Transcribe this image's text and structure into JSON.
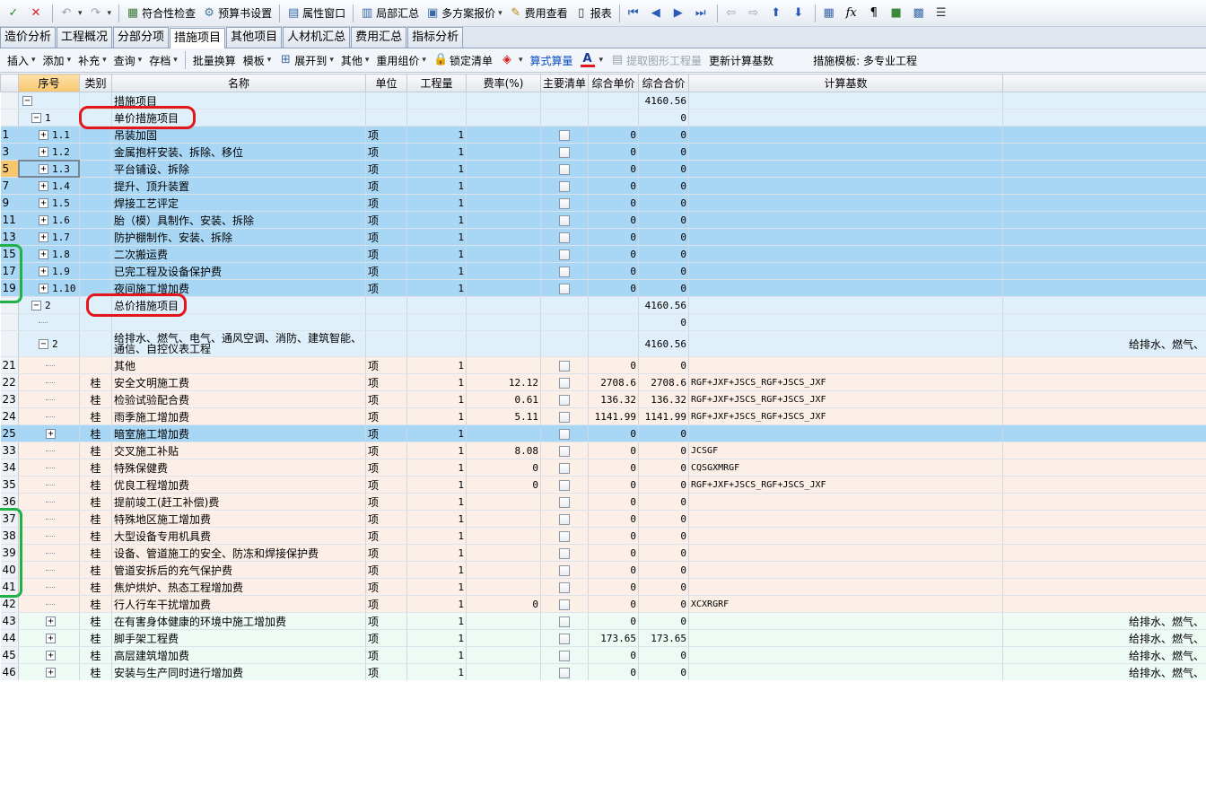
{
  "toolbar1": {
    "compliance_check": "符合性检查",
    "budget_settings": "预算书设置",
    "property_window": "属性窗口",
    "local_summary": "局部汇总",
    "multi_plan_quote": "多方案报价",
    "fee_view": "费用查看",
    "report": "报表"
  },
  "tabs": [
    "造价分析",
    "工程概况",
    "分部分项",
    "措施项目",
    "其他项目",
    "人材机汇总",
    "费用汇总",
    "指标分析"
  ],
  "active_tab": "措施项目",
  "toolbar2": {
    "insert": "插入",
    "add": "添加",
    "supplement": "补充",
    "query": "查询",
    "save": "存档",
    "batch_convert": "批量换算",
    "template": "模板",
    "expand_to": "展开到",
    "other": "其他",
    "reuse_price": "重用组价",
    "lock_list": "锁定清单",
    "formula_calc": "算式算量",
    "extract_quantity": "提取图形工程量",
    "update_base": "更新计算基数",
    "template_label": "措施模板:",
    "template_value": "多专业工程"
  },
  "columns": [
    "序号",
    "类别",
    "名称",
    "单位",
    "工程量",
    "费率(%)",
    "主要清单",
    "综合单价",
    "综合合价",
    "计算基数"
  ],
  "rows": [
    {
      "rn": "",
      "seq": "",
      "cat": "",
      "name": "措施项目",
      "unit": "",
      "qty": "",
      "rate": "",
      "cb": false,
      "price": "",
      "total": "4160.56",
      "base": "",
      "extra": "",
      "style": "hdr",
      "lvl": 0,
      "toggle": "−"
    },
    {
      "rn": "",
      "seq": "1",
      "cat": "",
      "name": "单价措施项目",
      "unit": "",
      "qty": "",
      "rate": "",
      "cb": false,
      "price": "",
      "total": "0",
      "base": "",
      "extra": "",
      "style": "hdr",
      "lvl": 1,
      "toggle": "−"
    },
    {
      "rn": "1",
      "seq": "1.1",
      "cat": "",
      "name": "吊装加固",
      "unit": "项",
      "qty": "1",
      "rate": "",
      "cb": true,
      "price": "0",
      "total": "0",
      "base": "",
      "extra": "",
      "style": "blue",
      "lvl": 2,
      "toggle": "+"
    },
    {
      "rn": "3",
      "seq": "1.2",
      "cat": "",
      "name": "金属抱杆安装、拆除、移位",
      "unit": "项",
      "qty": "1",
      "rate": "",
      "cb": true,
      "price": "0",
      "total": "0",
      "base": "",
      "extra": "",
      "style": "blue",
      "lvl": 2,
      "toggle": "+"
    },
    {
      "rn": "5",
      "seq": "1.3",
      "cat": "",
      "name": "平台铺设、拆除",
      "unit": "项",
      "qty": "1",
      "rate": "",
      "cb": true,
      "price": "0",
      "total": "0",
      "base": "",
      "extra": "",
      "style": "blue",
      "lvl": 2,
      "toggle": "+",
      "sel": true
    },
    {
      "rn": "7",
      "seq": "1.4",
      "cat": "",
      "name": "提升、顶升装置",
      "unit": "项",
      "qty": "1",
      "rate": "",
      "cb": true,
      "price": "0",
      "total": "0",
      "base": "",
      "extra": "",
      "style": "blue",
      "lvl": 2,
      "toggle": "+"
    },
    {
      "rn": "9",
      "seq": "1.5",
      "cat": "",
      "name": "焊接工艺评定",
      "unit": "项",
      "qty": "1",
      "rate": "",
      "cb": true,
      "price": "0",
      "total": "0",
      "base": "",
      "extra": "",
      "style": "blue",
      "lvl": 2,
      "toggle": "+"
    },
    {
      "rn": "11",
      "seq": "1.6",
      "cat": "",
      "name": "胎（模）具制作、安装、拆除",
      "unit": "项",
      "qty": "1",
      "rate": "",
      "cb": true,
      "price": "0",
      "total": "0",
      "base": "",
      "extra": "",
      "style": "blue",
      "lvl": 2,
      "toggle": "+"
    },
    {
      "rn": "13",
      "seq": "1.7",
      "cat": "",
      "name": "防护棚制作、安装、拆除",
      "unit": "项",
      "qty": "1",
      "rate": "",
      "cb": true,
      "price": "0",
      "total": "0",
      "base": "",
      "extra": "",
      "style": "blue",
      "lvl": 2,
      "toggle": "+"
    },
    {
      "rn": "15",
      "seq": "1.8",
      "cat": "",
      "name": "二次搬运费",
      "unit": "项",
      "qty": "1",
      "rate": "",
      "cb": true,
      "price": "0",
      "total": "0",
      "base": "",
      "extra": "",
      "style": "blue",
      "lvl": 2,
      "toggle": "+"
    },
    {
      "rn": "17",
      "seq": "1.9",
      "cat": "",
      "name": "已完工程及设备保护费",
      "unit": "项",
      "qty": "1",
      "rate": "",
      "cb": true,
      "price": "0",
      "total": "0",
      "base": "",
      "extra": "",
      "style": "blue",
      "lvl": 2,
      "toggle": "+"
    },
    {
      "rn": "19",
      "seq": "1.10",
      "cat": "",
      "name": "夜间施工增加费",
      "unit": "项",
      "qty": "1",
      "rate": "",
      "cb": true,
      "price": "0",
      "total": "0",
      "base": "",
      "extra": "",
      "style": "blue",
      "lvl": 2,
      "toggle": "+"
    },
    {
      "rn": "",
      "seq": "2",
      "cat": "",
      "name": "总价措施项目",
      "unit": "",
      "qty": "",
      "rate": "",
      "cb": false,
      "price": "",
      "total": "4160.56",
      "base": "",
      "extra": "",
      "style": "hdr",
      "lvl": 1,
      "toggle": "−"
    },
    {
      "rn": "",
      "seq": "",
      "cat": "",
      "name": "",
      "unit": "",
      "qty": "",
      "rate": "",
      "cb": false,
      "price": "",
      "total": "0",
      "base": "",
      "extra": "",
      "style": "hdr",
      "lvl": 2,
      "toggle": ""
    },
    {
      "rn": "",
      "seq": "2",
      "cat": "",
      "name": "给排水、燃气、电气、通风空调、消防、建筑智能、通信、自控仪表工程",
      "unit": "",
      "qty": "",
      "rate": "",
      "cb": false,
      "price": "",
      "total": "4160.56",
      "base": "",
      "extra": "给排水、燃气、",
      "style": "hdr tall",
      "lvl": 2,
      "toggle": "−"
    },
    {
      "rn": "21",
      "seq": "",
      "cat": "",
      "name": "其他",
      "unit": "项",
      "qty": "1",
      "rate": "",
      "cb": true,
      "price": "0",
      "total": "0",
      "base": "",
      "extra": "",
      "style": "pink",
      "lvl": 3,
      "toggle": ""
    },
    {
      "rn": "22",
      "seq": "",
      "cat": "桂",
      "name": "安全文明施工费",
      "unit": "项",
      "qty": "1",
      "rate": "12.12",
      "cb": true,
      "price": "2708.6",
      "total": "2708.6",
      "base": "RGF+JXF+JSCS_RGF+JSCS_JXF",
      "extra": "",
      "style": "pink",
      "lvl": 3,
      "toggle": ""
    },
    {
      "rn": "23",
      "seq": "",
      "cat": "桂",
      "name": "检验试验配合费",
      "unit": "项",
      "qty": "1",
      "rate": "0.61",
      "cb": true,
      "price": "136.32",
      "total": "136.32",
      "base": "RGF+JXF+JSCS_RGF+JSCS_JXF",
      "extra": "",
      "style": "pink",
      "lvl": 3,
      "toggle": ""
    },
    {
      "rn": "24",
      "seq": "",
      "cat": "桂",
      "name": "雨季施工增加费",
      "unit": "项",
      "qty": "1",
      "rate": "5.11",
      "cb": true,
      "price": "1141.99",
      "total": "1141.99",
      "base": "RGF+JXF+JSCS_RGF+JSCS_JXF",
      "extra": "",
      "style": "pink",
      "lvl": 3,
      "toggle": ""
    },
    {
      "rn": "25",
      "seq": "",
      "cat": "桂",
      "name": "暗室施工增加费",
      "unit": "项",
      "qty": "1",
      "rate": "",
      "cb": true,
      "price": "0",
      "total": "0",
      "base": "",
      "extra": "",
      "style": "blue",
      "lvl": 3,
      "toggle": "+"
    },
    {
      "rn": "33",
      "seq": "",
      "cat": "桂",
      "name": "交叉施工补贴",
      "unit": "项",
      "qty": "1",
      "rate": "8.08",
      "cb": true,
      "price": "0",
      "total": "0",
      "base": "JCSGF",
      "extra": "",
      "style": "pink",
      "lvl": 3,
      "toggle": ""
    },
    {
      "rn": "34",
      "seq": "",
      "cat": "桂",
      "name": "特殊保健费",
      "unit": "项",
      "qty": "1",
      "rate": "0",
      "cb": true,
      "price": "0",
      "total": "0",
      "base": "CQSGXMRGF",
      "extra": "",
      "style": "pink",
      "lvl": 3,
      "toggle": ""
    },
    {
      "rn": "35",
      "seq": "",
      "cat": "桂",
      "name": "优良工程增加费",
      "unit": "项",
      "qty": "1",
      "rate": "0",
      "cb": true,
      "price": "0",
      "total": "0",
      "base": "RGF+JXF+JSCS_RGF+JSCS_JXF",
      "extra": "",
      "style": "pink",
      "lvl": 3,
      "toggle": ""
    },
    {
      "rn": "36",
      "seq": "",
      "cat": "桂",
      "name": "提前竣工(赶工补偿)费",
      "unit": "项",
      "qty": "1",
      "rate": "",
      "cb": true,
      "price": "0",
      "total": "0",
      "base": "",
      "extra": "",
      "style": "pink",
      "lvl": 3,
      "toggle": ""
    },
    {
      "rn": "37",
      "seq": "",
      "cat": "桂",
      "name": "特殊地区施工增加费",
      "unit": "项",
      "qty": "1",
      "rate": "",
      "cb": true,
      "price": "0",
      "total": "0",
      "base": "",
      "extra": "",
      "style": "pink",
      "lvl": 3,
      "toggle": ""
    },
    {
      "rn": "38",
      "seq": "",
      "cat": "桂",
      "name": "大型设备专用机具费",
      "unit": "项",
      "qty": "1",
      "rate": "",
      "cb": true,
      "price": "0",
      "total": "0",
      "base": "",
      "extra": "",
      "style": "pink",
      "lvl": 3,
      "toggle": ""
    },
    {
      "rn": "39",
      "seq": "",
      "cat": "桂",
      "name": "设备、管道施工的安全、防冻和焊接保护费",
      "unit": "项",
      "qty": "1",
      "rate": "",
      "cb": true,
      "price": "0",
      "total": "0",
      "base": "",
      "extra": "",
      "style": "pink",
      "lvl": 3,
      "toggle": ""
    },
    {
      "rn": "40",
      "seq": "",
      "cat": "桂",
      "name": "管道安拆后的充气保护费",
      "unit": "项",
      "qty": "1",
      "rate": "",
      "cb": true,
      "price": "0",
      "total": "0",
      "base": "",
      "extra": "",
      "style": "pink",
      "lvl": 3,
      "toggle": ""
    },
    {
      "rn": "41",
      "seq": "",
      "cat": "桂",
      "name": "焦炉烘炉、热态工程增加费",
      "unit": "项",
      "qty": "1",
      "rate": "",
      "cb": true,
      "price": "0",
      "total": "0",
      "base": "",
      "extra": "",
      "style": "pink",
      "lvl": 3,
      "toggle": ""
    },
    {
      "rn": "42",
      "seq": "",
      "cat": "桂",
      "name": "行人行车干扰增加费",
      "unit": "项",
      "qty": "1",
      "rate": "0",
      "cb": true,
      "price": "0",
      "total": "0",
      "base": "XCXRGRF",
      "extra": "",
      "style": "pink",
      "lvl": 3,
      "toggle": ""
    },
    {
      "rn": "43",
      "seq": "",
      "cat": "桂",
      "name": "在有害身体健康的环境中施工增加费",
      "unit": "项",
      "qty": "1",
      "rate": "",
      "cb": true,
      "price": "0",
      "total": "0",
      "base": "",
      "extra": "给排水、燃气、",
      "style": "green",
      "lvl": 3,
      "toggle": "+"
    },
    {
      "rn": "44",
      "seq": "",
      "cat": "桂",
      "name": "脚手架工程费",
      "unit": "项",
      "qty": "1",
      "rate": "",
      "cb": true,
      "price": "173.65",
      "total": "173.65",
      "base": "",
      "extra": "给排水、燃气、",
      "style": "green",
      "lvl": 3,
      "toggle": "+"
    },
    {
      "rn": "45",
      "seq": "",
      "cat": "桂",
      "name": "高层建筑增加费",
      "unit": "项",
      "qty": "1",
      "rate": "",
      "cb": true,
      "price": "0",
      "total": "0",
      "base": "",
      "extra": "给排水、燃气、",
      "style": "green",
      "lvl": 3,
      "toggle": "+"
    },
    {
      "rn": "46",
      "seq": "",
      "cat": "桂",
      "name": "安装与生产同时进行增加费",
      "unit": "项",
      "qty": "1",
      "rate": "",
      "cb": true,
      "price": "0",
      "total": "0",
      "base": "",
      "extra": "给排水、燃气、",
      "style": "green",
      "lvl": 3,
      "toggle": "+"
    }
  ],
  "colors": {
    "highlight_blue": "#a8d6f5",
    "header_row": "#dff0fb",
    "pink_row": "#fcefe8",
    "green_row": "#eefaf4",
    "annotation_red": "#e3161b",
    "annotation_green": "#22b04a"
  },
  "icons": [
    "check-icon",
    "delete-icon",
    "undo-icon",
    "redo-icon",
    "grid-icon",
    "gear-icon",
    "window-icon",
    "summary-icon",
    "quote-icon",
    "fee-icon",
    "report-icon",
    "first-icon",
    "prev-icon",
    "next-icon",
    "last-icon",
    "left-icon",
    "right-icon",
    "up-icon",
    "down-icon",
    "calculator-icon",
    "fx-icon",
    "paragraph-icon",
    "cube-icon",
    "image-icon",
    "list-icon"
  ]
}
